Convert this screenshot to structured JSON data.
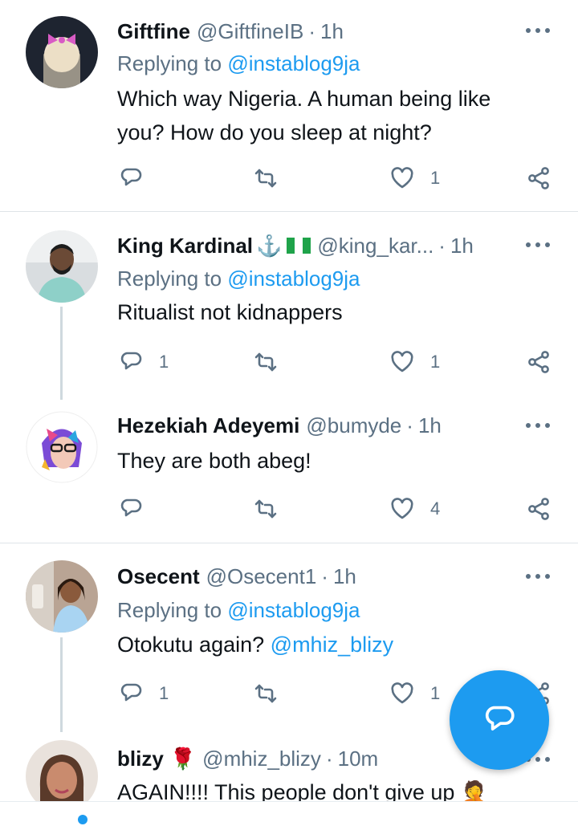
{
  "colors": {
    "accent": "#1d9bf0",
    "secondary_text": "#5b7083",
    "primary_text": "#0f1419",
    "divider": "#dfe4e8"
  },
  "tweets": [
    {
      "name": "Giftfine",
      "handle": "@GiftfineIB",
      "sep": "·",
      "time": "1h",
      "reply_prefix": "Replying to",
      "reply_to": "@instablog9ja",
      "body_lines": [
        "Which way Nigeria. A human being like",
        "you? How do you sleep at night?"
      ],
      "reply_count": "",
      "retweet_count": "",
      "like_count": "1"
    },
    {
      "name": "King Kardinal",
      "name_emoji": "⚓",
      "handle": "@king_kar...",
      "sep": "·",
      "time": "1h",
      "reply_prefix": "Replying to",
      "reply_to": "@instablog9ja",
      "body": "Ritualist not kidnappers",
      "reply_count": "1",
      "retweet_count": "",
      "like_count": "1"
    },
    {
      "name": "Hezekiah Adeyemi",
      "handle": "@bumyde",
      "sep": "·",
      "time": "1h",
      "body": "They are both abeg!",
      "reply_count": "",
      "retweet_count": "",
      "like_count": "4"
    },
    {
      "name": "Osecent",
      "handle": "@Osecent1",
      "sep": "·",
      "time": "1h",
      "reply_prefix": "Replying to",
      "reply_to": "@instablog9ja",
      "body_prefix": "Otokutu again?",
      "body_mention": "@mhiz_blizy",
      "reply_count": "1",
      "retweet_count": "",
      "like_count": "1"
    },
    {
      "name": "blizy",
      "name_emoji": "🌹",
      "handle": "@mhiz_blizy",
      "sep": "·",
      "time": "10m",
      "body": "AGAIN!!!! This people don't give up",
      "body_emoji": "🤦"
    }
  ],
  "icons": {
    "more": "more-options-icon",
    "reply": "reply-icon",
    "retweet": "retweet-icon",
    "like": "heart-icon",
    "share": "share-icon",
    "compose": "compose-reply-icon"
  }
}
